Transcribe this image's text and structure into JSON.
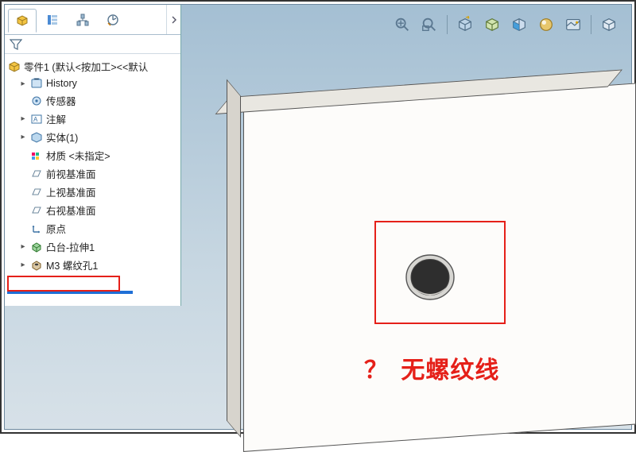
{
  "toolbar": {
    "buttons": [
      {
        "name": "zoom-fit-icon",
        "title": "Zoom to Fit"
      },
      {
        "name": "zoom-window-icon",
        "title": "Zoom Window"
      },
      {
        "name": "view-orientation-icon",
        "title": "View Orientation"
      },
      {
        "name": "display-style-icon",
        "title": "Display Style"
      },
      {
        "name": "section-view-icon",
        "title": "Section View"
      },
      {
        "name": "appearance-icon",
        "title": "Appearance"
      },
      {
        "name": "scene-icon",
        "title": "Scene"
      }
    ]
  },
  "panel_tabs": [
    {
      "name": "feature-manager-tab",
      "active": true
    },
    {
      "name": "property-manager-tab",
      "active": false
    },
    {
      "name": "config-manager-tab",
      "active": false
    },
    {
      "name": "dim-manager-tab",
      "active": false
    }
  ],
  "tree": {
    "root_label": "零件1 (默认<按加工><<默认",
    "items": [
      {
        "label": "History",
        "icon": "history-icon",
        "expandable": true
      },
      {
        "label": "传感器",
        "icon": "sensor-icon",
        "expandable": false
      },
      {
        "label": "注解",
        "icon": "annotation-icon",
        "expandable": true
      },
      {
        "label": "实体(1)",
        "icon": "solid-body-icon",
        "expandable": true
      },
      {
        "label": "材质 <未指定>",
        "icon": "material-icon",
        "expandable": false
      },
      {
        "label": "前视基准面",
        "icon": "plane-icon",
        "expandable": false
      },
      {
        "label": "上视基准面",
        "icon": "plane-icon",
        "expandable": false
      },
      {
        "label": "右视基准面",
        "icon": "plane-icon",
        "expandable": false
      },
      {
        "label": "原点",
        "icon": "origin-icon",
        "expandable": false
      },
      {
        "label": "凸台-拉伸1",
        "icon": "extrude-icon",
        "expandable": true
      },
      {
        "label": "M3 螺纹孔1",
        "icon": "hole-wizard-icon",
        "expandable": true,
        "highlighted": true
      }
    ]
  },
  "annotation": {
    "question_mark": "？",
    "text": "无螺纹线"
  },
  "colors": {
    "red": "#e52019",
    "blue": "#1f6fd6"
  }
}
